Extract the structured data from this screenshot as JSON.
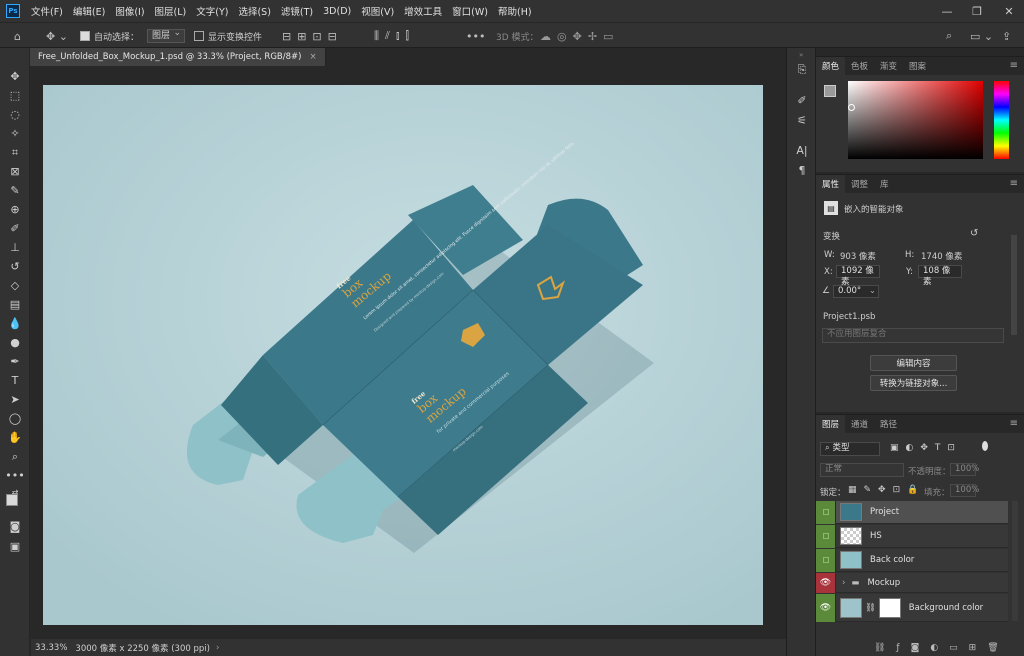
{
  "menu": {
    "logo": "Ps",
    "items": [
      "文件(F)",
      "编辑(E)",
      "图像(I)",
      "图层(L)",
      "文字(Y)",
      "选择(S)",
      "滤镜(T)",
      "3D(D)",
      "视图(V)",
      "增效工具",
      "窗口(W)",
      "帮助(H)"
    ]
  },
  "options": {
    "auto_select_label": "自动选择：",
    "auto_select_value": "图层",
    "transform_label": "显示变换控件",
    "mode_3d_label": "3D 模式："
  },
  "document": {
    "tab_title": "Free_Unfolded_Box_Mockup_1.psd @ 33.3% (Project, RGB/8#)",
    "close": "×"
  },
  "status": {
    "zoom": "33.33%",
    "size": "3000 像素 x 2250 像素 (300 ppi)",
    "arrow": "›"
  },
  "mockup": {
    "free_1": "free",
    "box_1": "box",
    "mockup_1": "mockup",
    "body": "Lorem ipsum dolor sit amet, consectetur adipiscing elit. Fusce dignissim sem sollicitudin, interdum nisi id, ultrices felis.",
    "credit": "Designed and prepared by mockup-design.com",
    "free_2": "free",
    "box_2": "box",
    "mockup_2": "mockup",
    "purpose": "for private and commercial purposes",
    "url": "mockup-design.com"
  },
  "color_panel": {
    "tabs": [
      "颜色",
      "色板",
      "渐变",
      "图案"
    ]
  },
  "properties_panel": {
    "tabs": [
      "属性",
      "调整",
      "库"
    ],
    "type_label": "嵌入的智能对象",
    "transform_title": "变换",
    "w_label": "W:",
    "w_value": "903 像素",
    "h_label": "H:",
    "h_value": "1740 像素",
    "x_label": "X:",
    "x_value": "1092 像素",
    "y_label": "Y:",
    "y_value": "108 像素",
    "angle_value": "0.00°",
    "file_name": "Project1.psb",
    "comp_placeholder": "不应用图层复合",
    "edit_button": "编辑内容",
    "convert_button": "转换为链接对象..."
  },
  "layers_panel": {
    "tabs": [
      "图层",
      "通道",
      "路径"
    ],
    "filter_kind": "类型",
    "blend_mode": "正常",
    "opacity_label": "不透明度：",
    "opacity_value": "100%",
    "lock_label": "锁定：",
    "fill_label": "填充：",
    "fill_value": "100%",
    "layers": [
      "Project",
      "HS",
      "Back color",
      "Mockup",
      "Background color"
    ]
  },
  "colors": {
    "canvas_bg": "#b9d4d9",
    "box": "#3b7889",
    "flap": "#8fc1c9",
    "gold": "#d9a441",
    "accent": "#31a8ff"
  }
}
